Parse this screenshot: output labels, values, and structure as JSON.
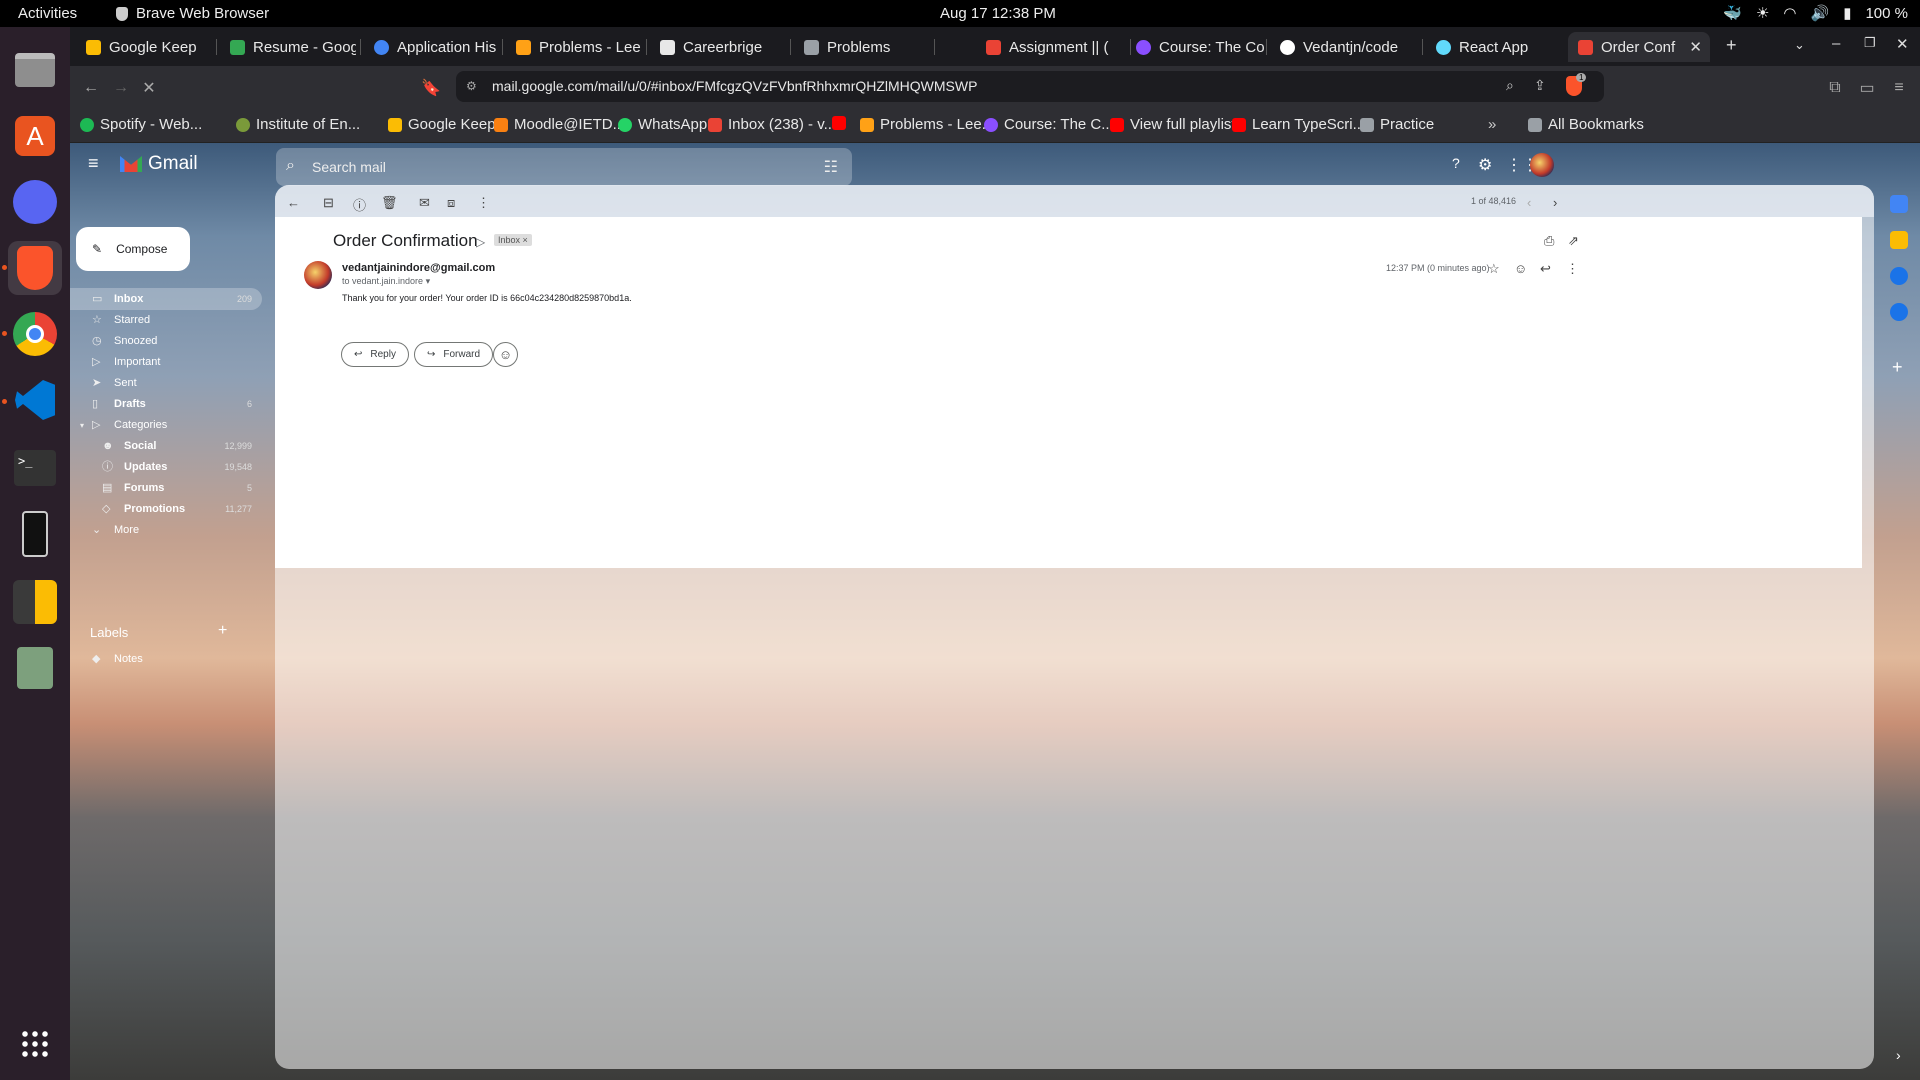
{
  "system": {
    "activities": "Activities",
    "app_name": "Brave Web Browser",
    "clock": "Aug 17  12:38 PM",
    "battery": "100 %"
  },
  "tabs": [
    {
      "label": "Google Keep",
      "color": "#fbbc04"
    },
    {
      "label": "Resume - Goog",
      "color": "#34a853"
    },
    {
      "label": "Application His",
      "color": "#4285f4"
    },
    {
      "label": "Problems - Lee",
      "color": "#ffa116"
    },
    {
      "label": "Careerbrige",
      "color": "#e8e8e8"
    },
    {
      "label": "Problems",
      "color": "#9aa0a6"
    },
    {
      "label": "Assignment || (",
      "color": "#ea4335"
    },
    {
      "label": "Course: The Co",
      "color": "#8a4fff"
    },
    {
      "label": "Vedantjn/code",
      "color": "#ffffff"
    },
    {
      "label": "React App",
      "color": "#61dafb"
    },
    {
      "label": "Order Conf",
      "color": "#ea4335"
    }
  ],
  "address_bar": {
    "url": "mail.google.com/mail/u/0/#inbox/FMfcgzQVzFVbnfRhhxmrQHZlMHQWMSWP",
    "shield_count": "1"
  },
  "bookmarks": [
    {
      "label": "Spotify - Web...",
      "color": "#1db954"
    },
    {
      "label": "Institute of En...",
      "color": "#7a9a3a"
    },
    {
      "label": "Google Keep",
      "color": "#fbbc04"
    },
    {
      "label": "Moodle@IETD...",
      "color": "#f98012"
    },
    {
      "label": "WhatsApp",
      "color": "#25d366"
    },
    {
      "label": "Inbox (238) - v...",
      "color": "#ea4335"
    },
    {
      "label": "",
      "color": "#ff0000"
    },
    {
      "label": "Problems - Lee...",
      "color": "#ffa116"
    },
    {
      "label": "Course: The C...",
      "color": "#8a4fff"
    },
    {
      "label": "View full playlist",
      "color": "#ff0000"
    },
    {
      "label": "Learn TypeScri...",
      "color": "#ff0000"
    },
    {
      "label": "Practice",
      "color": "#9aa0a6"
    },
    {
      "label": "All Bookmarks",
      "color": "#9aa0a6"
    }
  ],
  "gmail": {
    "logo_text": "Gmail",
    "search_placeholder": "Search mail",
    "compose_label": "Compose",
    "nav": [
      {
        "label": "Inbox",
        "count": "209",
        "icon": "inbox-icon"
      },
      {
        "label": "Starred",
        "count": "",
        "icon": "star-icon"
      },
      {
        "label": "Snoozed",
        "count": "",
        "icon": "clock-icon"
      },
      {
        "label": "Important",
        "count": "",
        "icon": "important-icon"
      },
      {
        "label": "Sent",
        "count": "",
        "icon": "send-icon"
      },
      {
        "label": "Drafts",
        "count": "6",
        "icon": "draft-icon"
      },
      {
        "label": "Categories",
        "count": "",
        "icon": "label-icon"
      },
      {
        "label": "Social",
        "count": "12,999",
        "icon": "people-icon"
      },
      {
        "label": "Updates",
        "count": "19,548",
        "icon": "info-icon"
      },
      {
        "label": "Forums",
        "count": "5",
        "icon": "forum-icon"
      },
      {
        "label": "Promotions",
        "count": "11,277",
        "icon": "tag-icon"
      },
      {
        "label": "More",
        "count": "",
        "icon": "chevron-down-icon"
      }
    ],
    "labels_heading": "Labels",
    "labels": [
      {
        "label": "Notes"
      }
    ],
    "pagination": "1 of 48,416",
    "email": {
      "subject": "Order Confirmation",
      "inbox_chip": "Inbox ×",
      "sender": "vedantjainindore@gmail.com",
      "to": "to vedant.jain.indore",
      "time": "12:37 PM (0 minutes ago)",
      "body": "Thank you for your order! Your order ID is 66c04c234280d8259870bd1a.",
      "reply_label": "Reply",
      "forward_label": "Forward"
    }
  }
}
